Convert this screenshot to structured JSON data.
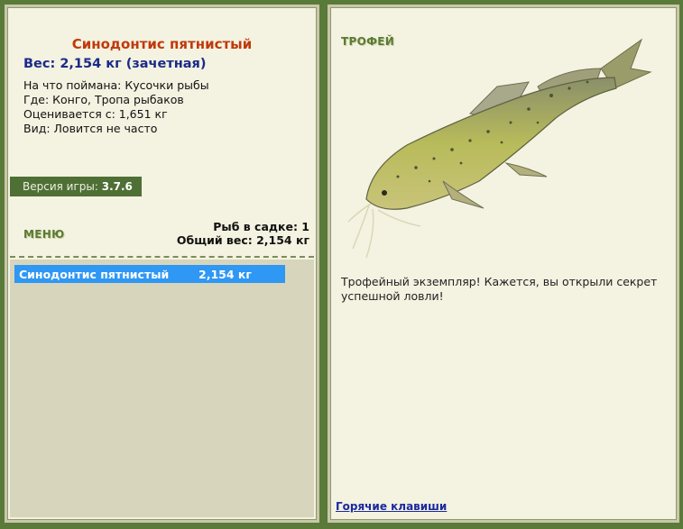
{
  "fish": {
    "name": "Синодонтис пятнистый",
    "weight_line": "Вес: 2,154 кг (зачетная)",
    "bait_line": "На что поймана: Кусочки рыбы",
    "where_line": "Где: Конго, Тропа рыбаков",
    "value_line": "Оценивается с: 1,651 кг",
    "kind_line": "Вид: Ловится не часто"
  },
  "version": {
    "label": "Версия игры:",
    "value": "3.7.6"
  },
  "menu": {
    "label": "МЕНЮ"
  },
  "cage": {
    "count_line": "Рыб в садке: 1",
    "total_line": "Общий вес: 2,154 кг"
  },
  "catch_list": [
    {
      "name": "Синодонтис пятнистый",
      "weight": "2,154 кг"
    }
  ],
  "trophy": {
    "label": "ТРОФЕЙ",
    "text": "Трофейный экземпляр! Кажется, вы открыли секрет успешной ловли!"
  },
  "hotkeys": {
    "label": "Горячие клавиши"
  },
  "colors": {
    "background": "#5a7a3a",
    "panel": "#f4f2e0",
    "fish_title": "#c0390b",
    "weight": "#1b2a8a",
    "selected_row": "#2f97f4",
    "list_bg": "#d7d6bd"
  }
}
